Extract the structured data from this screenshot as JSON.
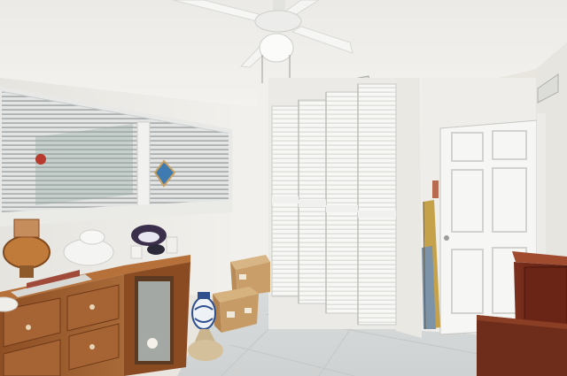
{
  "scene": {
    "room": "bedroom",
    "description_note": "",
    "colors": {
      "wall": "#f1f0ec",
      "wall_shadow": "#e2e0da",
      "ceiling": "#efeeea",
      "floor": "#d9dcdc",
      "closet_door": "#f7f7f5",
      "louver_line": "#d4d4d0",
      "door": "#f6f6f4",
      "wood_light": "#9a5a2c",
      "wood_dark": "#6b2a18",
      "box": "#c9a06e",
      "window_blind": "#dadcdc"
    },
    "objects": [
      "ceiling-fan",
      "air-vent",
      "window-with-blinds",
      "louvered-closet-doors",
      "panel-door",
      "wooden-sideboard",
      "cardboard-boxes",
      "ginger-jar",
      "rolled-rug",
      "wooden-cabinet",
      "teapots-and-decor"
    ]
  }
}
